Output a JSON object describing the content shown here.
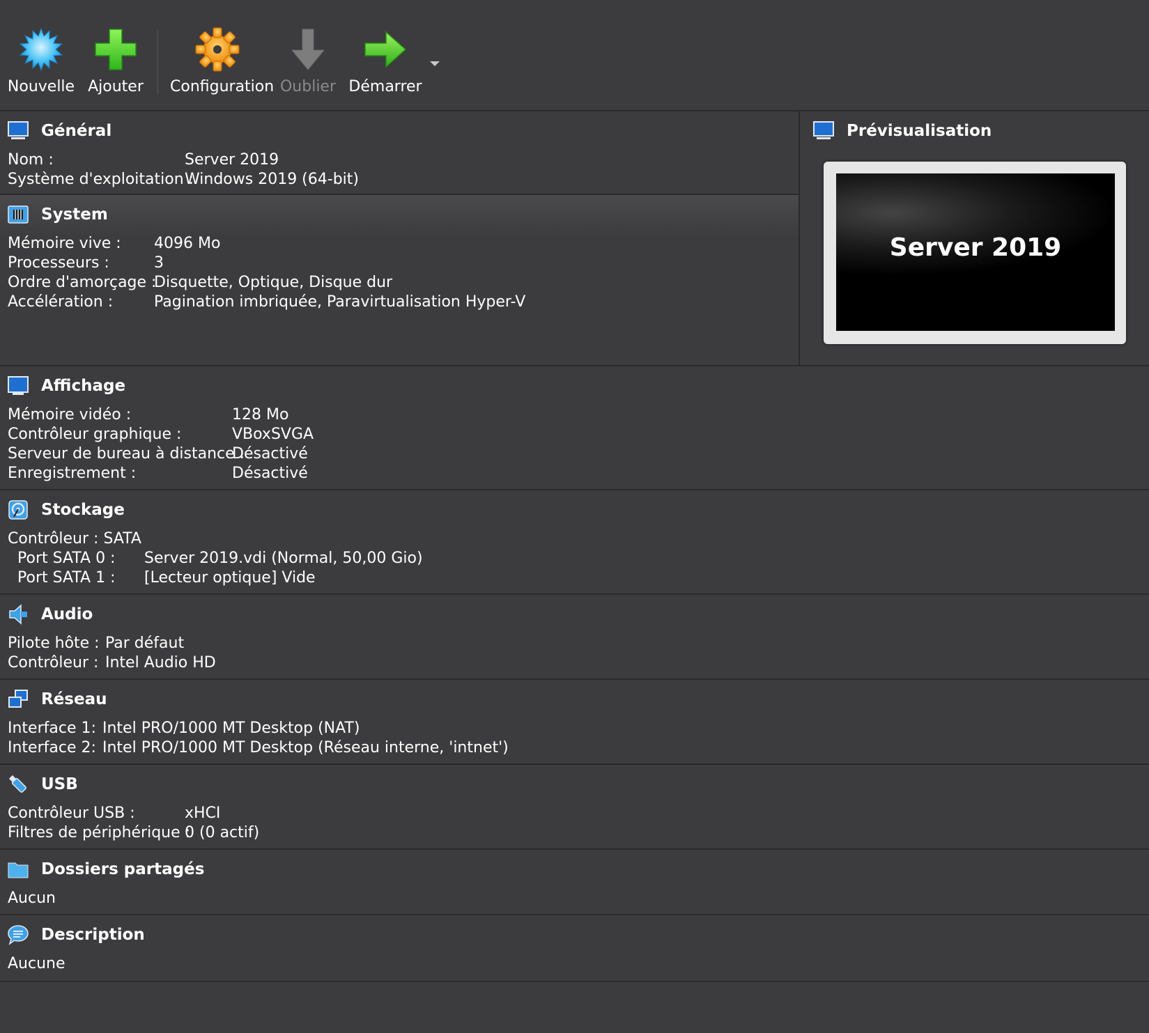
{
  "toolbar": {
    "new_label": "Nouvelle",
    "add_label": "Ajouter",
    "settings_label": "Configuration",
    "discard_label": "Oublier",
    "start_label": "Démarrer"
  },
  "general": {
    "title": "Général",
    "rows": [
      {
        "k": "Nom :",
        "v": "Server 2019"
      },
      {
        "k": "Système d'exploitation :",
        "v": "Windows 2019 (64-bit)"
      }
    ]
  },
  "system": {
    "title": "System",
    "rows": [
      {
        "k": "Mémoire vive :",
        "v": "4096 Mo"
      },
      {
        "k": "Processeurs :",
        "v": "3"
      },
      {
        "k": "Ordre d'amorçage :",
        "v": "Disquette, Optique, Disque dur"
      },
      {
        "k": "Accélération :",
        "v": "Pagination imbriquée, Paravirtualisation Hyper-V"
      }
    ]
  },
  "preview": {
    "title": "Prévisualisation",
    "screen_text": "Server 2019"
  },
  "display": {
    "title": "Affichage",
    "rows": [
      {
        "k": "Mémoire vidéo :",
        "v": "128 Mo"
      },
      {
        "k": "Contrôleur graphique :",
        "v": "VBoxSVGA"
      },
      {
        "k": "Serveur de bureau à distance :",
        "v": "Désactivé"
      },
      {
        "k": "Enregistrement :",
        "v": "Désactivé"
      }
    ]
  },
  "storage": {
    "title": "Stockage",
    "controller": "Contrôleur : SATA",
    "rows": [
      {
        "k": "Port SATA 0 :",
        "v": "Server 2019.vdi (Normal, 50,00 Gio)"
      },
      {
        "k": "Port SATA 1 :",
        "v": "[Lecteur optique] Vide"
      }
    ]
  },
  "audio": {
    "title": "Audio",
    "rows": [
      {
        "k": "Pilote hôte :",
        "v": "Par défaut"
      },
      {
        "k": "Contrôleur :",
        "v": "Intel Audio HD"
      }
    ]
  },
  "network": {
    "title": "Réseau",
    "rows": [
      {
        "k": "Interface 1:",
        "v": "Intel PRO/1000 MT Desktop (NAT)"
      },
      {
        "k": "Interface 2:",
        "v": "Intel PRO/1000 MT Desktop (Réseau interne, 'intnet')"
      }
    ]
  },
  "usb": {
    "title": "USB",
    "rows": [
      {
        "k": "Contrôleur USB :",
        "v": "xHCI"
      },
      {
        "k": "Filtres de périphérique :",
        "v": "0 (0 actif)"
      }
    ]
  },
  "shared": {
    "title": "Dossiers partagés",
    "value": "Aucun"
  },
  "description": {
    "title": "Description",
    "value": "Aucune"
  },
  "colors": {
    "background": "#3c3c3e",
    "separator": "#2a2a2b",
    "text": "#ffffff",
    "disabled_text": "#8a8a8a",
    "accent_blue": "#1f6fd1"
  },
  "icons": {
    "new": "starburst-icon",
    "add": "plus-icon",
    "settings": "gear-icon",
    "discard": "down-arrow-icon",
    "start": "right-arrow-icon"
  }
}
